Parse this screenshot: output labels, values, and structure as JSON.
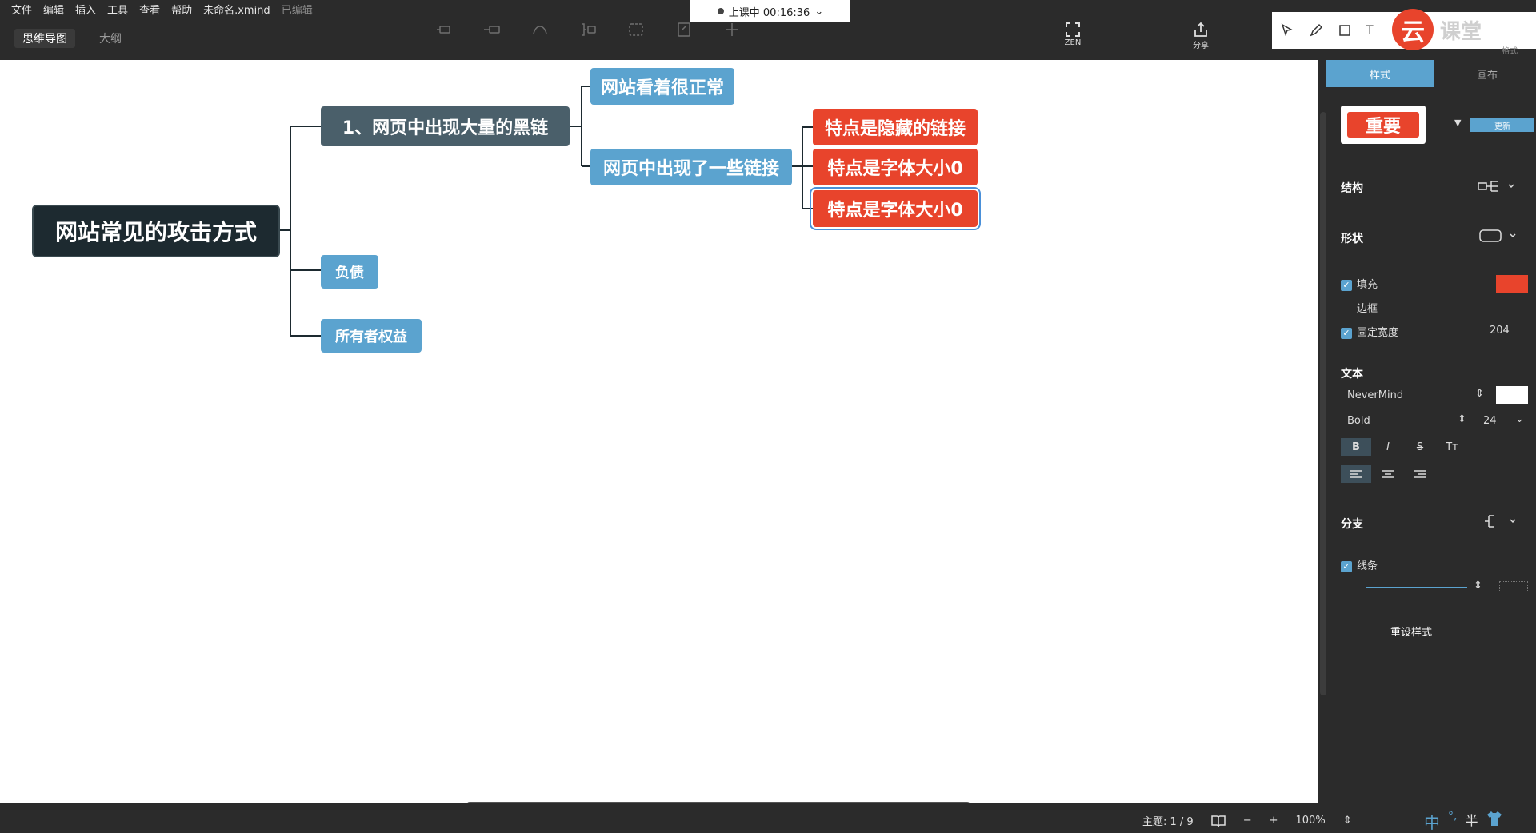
{
  "menu": {
    "items": [
      "文件",
      "编辑",
      "插入",
      "工具",
      "查看",
      "帮助"
    ],
    "filename": "未命名.xmind",
    "save_state": "已编辑"
  },
  "view_tabs": {
    "mindmap": "思维导图",
    "outline": "大纲"
  },
  "recording": {
    "text": "上课中 00:16:36",
    "caret": "⌄"
  },
  "toolbar": {
    "zen_label": "ZEN",
    "share_label": "分享",
    "format_label": "格式",
    "annot_text_tool": "T",
    "brand_logo": "云",
    "brand_text": "课堂"
  },
  "mindmap": {
    "central": "网站常见的攻击方式",
    "branch1": "1、网页中出现大量的黑链",
    "branch1_child1": "网站看着很正常",
    "branch1_child2": "网页中出现了一些链接",
    "leaf1": "特点是隐藏的链接",
    "leaf2": "特点是字体大小0",
    "leaf3": "特点是字体大小0",
    "branch2": "负债",
    "branch3": "所有者权益"
  },
  "panel": {
    "tab_style": "样式",
    "tab_canvas": "画布",
    "preset_label": "重要",
    "update_label": "更新",
    "structure": "结构",
    "shape": "形状",
    "fill": "填充",
    "border": "边框",
    "fixed_width": "固定宽度",
    "fixed_width_value": "204",
    "text_section": "文本",
    "font": "NeverMind",
    "weight": "Bold",
    "size": "24",
    "branch_section": "分支",
    "line": "线条",
    "reset": "重设样式",
    "bold_btn": "B",
    "italic_btn": "I",
    "strike_btn": "S",
    "case_btn": "Tт"
  },
  "status": {
    "topics": "主题: 1 / 9",
    "zoom": "100%",
    "minus": "−",
    "plus": "+",
    "ime": [
      "中",
      "°,",
      "半"
    ]
  },
  "colors": {
    "accent": "#5ba3cf",
    "red": "#e8442c",
    "central": "#1d2a30",
    "subtopic": "#4a5f6a"
  }
}
